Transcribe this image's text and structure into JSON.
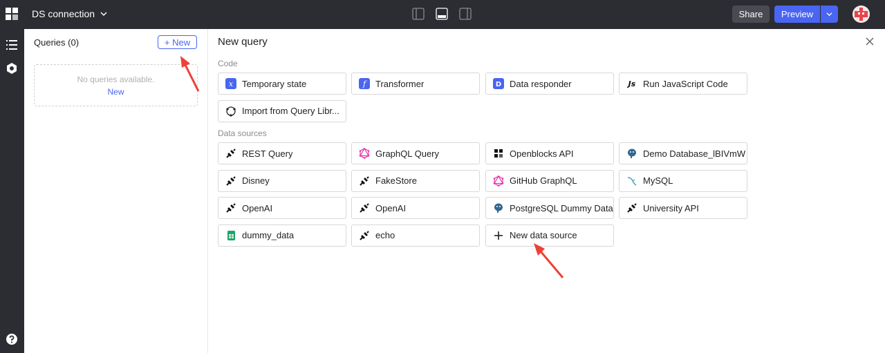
{
  "header": {
    "app_title": "DS connection",
    "share_label": "Share",
    "preview_label": "Preview"
  },
  "queries_panel": {
    "title": "Queries (0)",
    "new_label": "+ New",
    "empty_text": "No queries available.",
    "empty_link": "New"
  },
  "main": {
    "title": "New query",
    "code_section": "Code",
    "code_items": [
      {
        "label": "Temporary state",
        "icon": "temporary-state-icon"
      },
      {
        "label": "Transformer",
        "icon": "transformer-icon"
      },
      {
        "label": "Data responder",
        "icon": "data-responder-icon"
      },
      {
        "label": "Run JavaScript Code",
        "icon": "javascript-icon"
      },
      {
        "label": "Import from Query Libr...",
        "icon": "query-library-icon"
      }
    ],
    "ds_section": "Data sources",
    "ds_items": [
      {
        "label": "REST Query",
        "icon": "plug-icon"
      },
      {
        "label": "GraphQL Query",
        "icon": "graphql-icon"
      },
      {
        "label": "Openblocks API",
        "icon": "openblocks-icon"
      },
      {
        "label": "Demo Database_lBIVmW",
        "icon": "postgres-icon"
      },
      {
        "label": "Disney",
        "icon": "plug-icon"
      },
      {
        "label": "FakeStore",
        "icon": "plug-icon"
      },
      {
        "label": "GitHub GraphQL",
        "icon": "graphql-icon"
      },
      {
        "label": "MySQL",
        "icon": "mysql-icon"
      },
      {
        "label": "OpenAI",
        "icon": "plug-icon"
      },
      {
        "label": "OpenAI",
        "icon": "plug-icon"
      },
      {
        "label": "PostgreSQL Dummy Data",
        "icon": "postgres-icon"
      },
      {
        "label": "University API",
        "icon": "plug-icon"
      },
      {
        "label": "dummy_data",
        "icon": "google-sheets-icon"
      },
      {
        "label": "echo",
        "icon": "plug-icon"
      },
      {
        "label": "New data source",
        "icon": "plus-icon"
      }
    ]
  },
  "colors": {
    "accent": "#4965f2",
    "topbar": "#2c2d33",
    "annotation_arrow": "#ee4035"
  }
}
